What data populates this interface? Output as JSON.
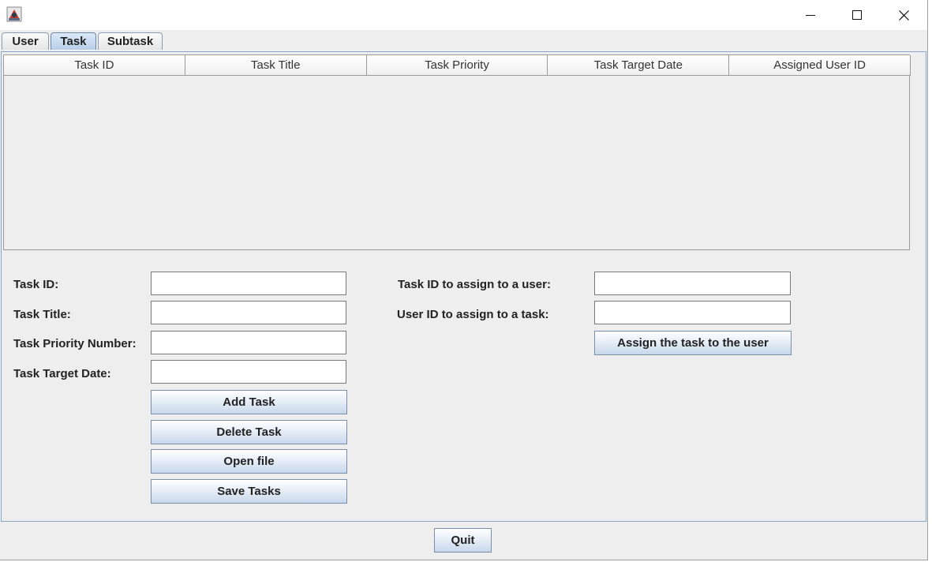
{
  "window": {
    "icon": "java-app-icon",
    "controls": {
      "minimize": "minimize-icon",
      "maximize": "maximize-icon",
      "close": "close-icon"
    }
  },
  "tabs": [
    {
      "label": "User"
    },
    {
      "label": "Task",
      "selected": true
    },
    {
      "label": "Subtask"
    }
  ],
  "table": {
    "columns": [
      "Task ID",
      "Task Title",
      "Task Priority",
      "Task Target Date",
      "Assigned User ID"
    ],
    "rows": []
  },
  "form": {
    "task_id_label": "Task ID:",
    "task_id_value": "",
    "task_title_label": "Task Title:",
    "task_title_value": "",
    "task_priority_label": "Task Priority Number:",
    "task_priority_value": "",
    "task_target_date_label": "Task Target Date:",
    "task_target_date_value": "",
    "add_task_label": "Add Task",
    "delete_task_label": "Delete Task",
    "open_file_label": "Open file",
    "save_tasks_label": "Save Tasks"
  },
  "assign": {
    "task_id_label": "Task ID to assign to a user:",
    "task_id_value": "",
    "user_id_label": "User ID to assign to a task:",
    "user_id_value": "",
    "assign_button_label": "Assign the task to the user"
  },
  "footer": {
    "quit_label": "Quit"
  },
  "colors": {
    "window_bg": "#eeeeee",
    "selected_tab": "#b8cfe9",
    "button_gradient_end": "#c8d8ec"
  }
}
